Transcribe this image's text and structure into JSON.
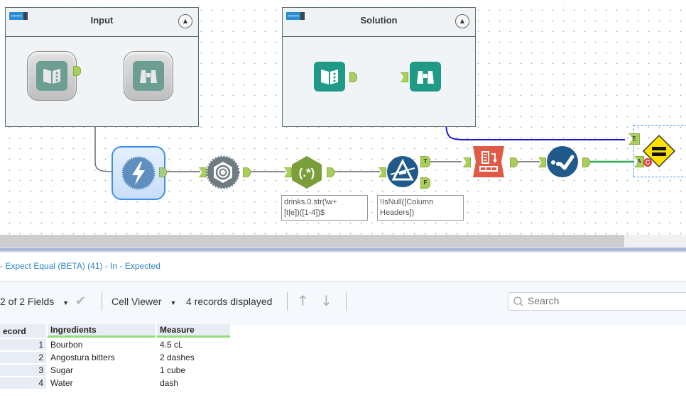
{
  "canvas": {
    "containers": [
      {
        "title": "Input",
        "toggle_icon": "container-toggle-icon",
        "collapse_icon": "chevron-up-icon"
      },
      {
        "title": "Solution",
        "toggle_icon": "container-toggle-icon",
        "collapse_icon": "chevron-up-icon"
      }
    ],
    "tools": [
      {
        "name": "input-data-tool",
        "icon": "book-icon",
        "container": "Input",
        "state": "disabled"
      },
      {
        "name": "browse-tool",
        "icon": "binoculars-icon",
        "container": "Input",
        "state": "disabled"
      },
      {
        "name": "input-data-tool",
        "icon": "book-icon",
        "container": "Solution"
      },
      {
        "name": "browse-tool",
        "icon": "binoculars-icon",
        "container": "Solution"
      },
      {
        "name": "macro-tool",
        "icon": "lightning-bolt-icon",
        "state": "selected"
      },
      {
        "name": "json-parse-tool",
        "icon": "spiral-gear-icon"
      },
      {
        "name": "regex-tool",
        "icon": "regex-icon",
        "glyph": "(.*)",
        "annotation": "drinks.0.str(\\w+\n[t|e])([1-4])$"
      },
      {
        "name": "filter-tool",
        "icon": "prism-filter-icon",
        "anchors": [
          "T",
          "F"
        ],
        "annotation": "!IsNull([Column\nHeaders])"
      },
      {
        "name": "crosstab-tool",
        "icon": "crosstab-icon"
      },
      {
        "name": "test-tool",
        "icon": "checkmark-dots-icon"
      },
      {
        "name": "expect-equal-tool",
        "icon": "equals-diamond-icon",
        "anchors": [
          "E",
          "A"
        ],
        "badge": "C"
      }
    ],
    "annotations": {
      "regex_line1": "drinks.0.str(\\w+",
      "regex_line2": "[t|e])([1-4])$",
      "filter_line1": "!IsNull([Column",
      "filter_line2": "Headers])"
    },
    "anchor_labels": {
      "true": "T",
      "false": "F",
      "expected": "E",
      "actual": "A",
      "badge": "C"
    },
    "colors": {
      "teal": "#1e9a87",
      "regex_green": "#7a9e3a",
      "filter_blue": "#1f5a8a",
      "crosstab_red": "#e05a45",
      "expect_yellow": "#ffe100",
      "wire_blue": "#1a1ad0",
      "wire_green": "#2fa84f"
    }
  },
  "results": {
    "title": "- Expect Equal (BETA) (41) - In - Expected",
    "toolbar": {
      "fields": "2 of 2 Fields",
      "cell_viewer": "Cell Viewer",
      "records": "4 records displayed",
      "search_placeholder": "Search"
    },
    "table": {
      "columns": [
        "ecord",
        "Ingredients",
        "Measure"
      ],
      "rows": [
        {
          "record": "1",
          "ingredients": "Bourbon",
          "measure": "4.5 cL"
        },
        {
          "record": "2",
          "ingredients": "Angostura bitters",
          "measure": "2 dashes"
        },
        {
          "record": "3",
          "ingredients": "Sugar",
          "measure": "1 cube"
        },
        {
          "record": "4",
          "ingredients": "Water",
          "measure": "dash"
        }
      ]
    }
  }
}
